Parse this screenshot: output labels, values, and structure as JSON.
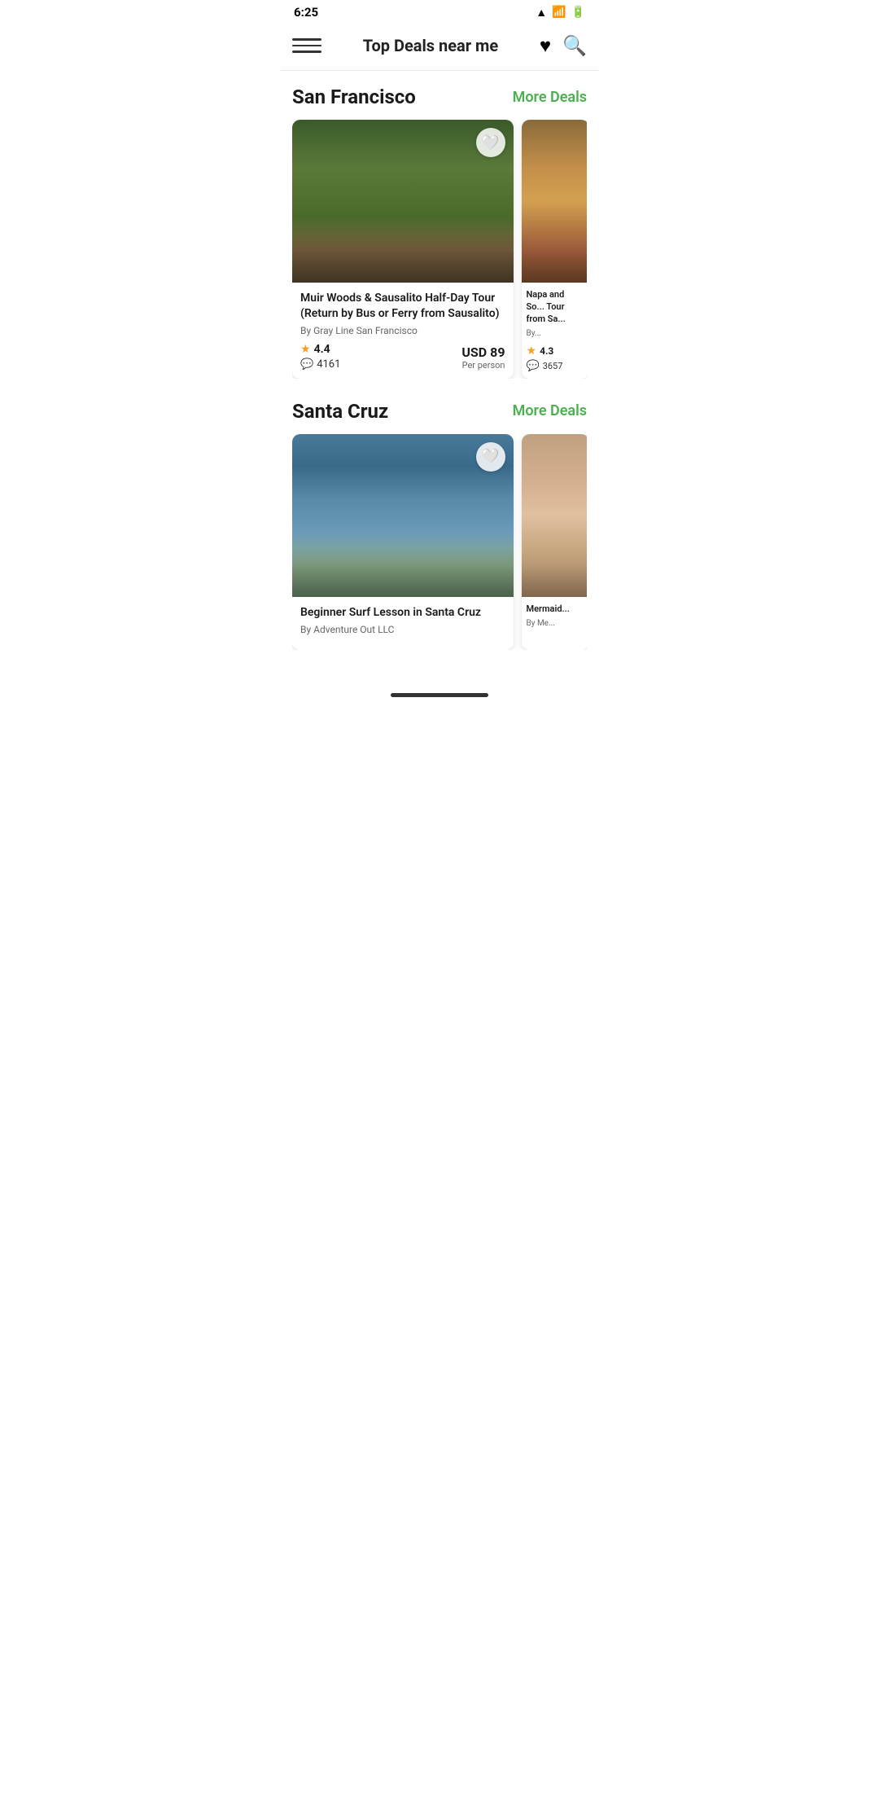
{
  "statusBar": {
    "time": "6:25",
    "icons": [
      "signal",
      "wifi",
      "battery"
    ]
  },
  "header": {
    "title": "Top Deals near me",
    "heartIcon": "♥",
    "searchIcon": "🔍",
    "menuIcon": "menu"
  },
  "sections": [
    {
      "id": "san-francisco",
      "title": "San Francisco",
      "moreDeals": "More Deals",
      "cards": [
        {
          "id": "muir-woods",
          "title": "Muir Woods & Sausalito Half-Day Tour (Return by Bus or Ferry from Sausalito)",
          "provider": "By Gray Line San Francisco",
          "rating": "4.4",
          "reviews": "4161",
          "price": "USD 89",
          "priceSub": "Per person",
          "imgClass": "img-forest",
          "hearted": false
        },
        {
          "id": "napa",
          "title": "Napa and So... Tour from Sa...",
          "provider": "By...",
          "rating": "4.3",
          "reviews": "3657",
          "price": "",
          "priceSub": "",
          "imgClass": "img-napa",
          "hearted": false,
          "partial": true
        }
      ]
    },
    {
      "id": "santa-cruz",
      "title": "Santa Cruz",
      "moreDeals": "More Deals",
      "cards": [
        {
          "id": "surf-lesson",
          "title": "Beginner Surf Lesson in Santa Cruz",
          "provider": "By Adventure Out LLC",
          "rating": "",
          "reviews": "",
          "price": "",
          "priceSub": "",
          "imgClass": "img-surf",
          "hearted": false
        },
        {
          "id": "mermaid",
          "title": "Mermaid...",
          "provider": "By Me...",
          "rating": "",
          "reviews": "",
          "price": "",
          "priceSub": "",
          "imgClass": "img-mermaid",
          "hearted": false,
          "partial": true
        }
      ]
    }
  ],
  "colors": {
    "accent": "#4CAF50",
    "starColor": "#f4a020",
    "textDark": "#1a1a1a",
    "textMid": "#666666"
  }
}
